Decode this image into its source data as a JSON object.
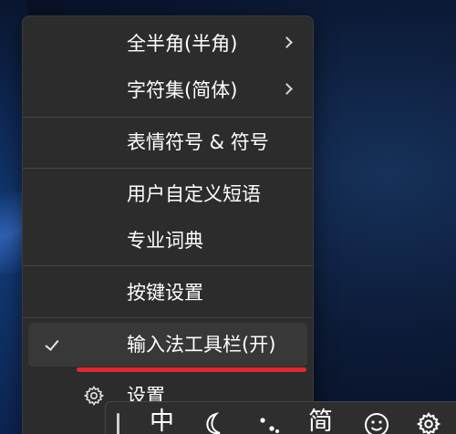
{
  "menu": {
    "items": [
      {
        "label": "全半角(半角)",
        "has_submenu": true
      },
      {
        "label": "字符集(简体)",
        "has_submenu": true
      },
      {
        "label": "表情符号 & 符号"
      },
      {
        "label": "用户自定义短语"
      },
      {
        "label": "专业词典"
      },
      {
        "label": "按键设置"
      },
      {
        "label": "输入法工具栏(开)",
        "checked": true
      },
      {
        "label": "设置",
        "icon": "gear-icon"
      }
    ]
  },
  "toolbar": {
    "mode_label": "中",
    "charset_label": "简",
    "icons": [
      "half-moon-icon",
      "punctuation-icon",
      "emoji-icon",
      "gear-icon"
    ]
  },
  "colors": {
    "menu_bg": "#2c2c2c",
    "highlight": "#383838",
    "annotation_red": "#e3262c"
  }
}
